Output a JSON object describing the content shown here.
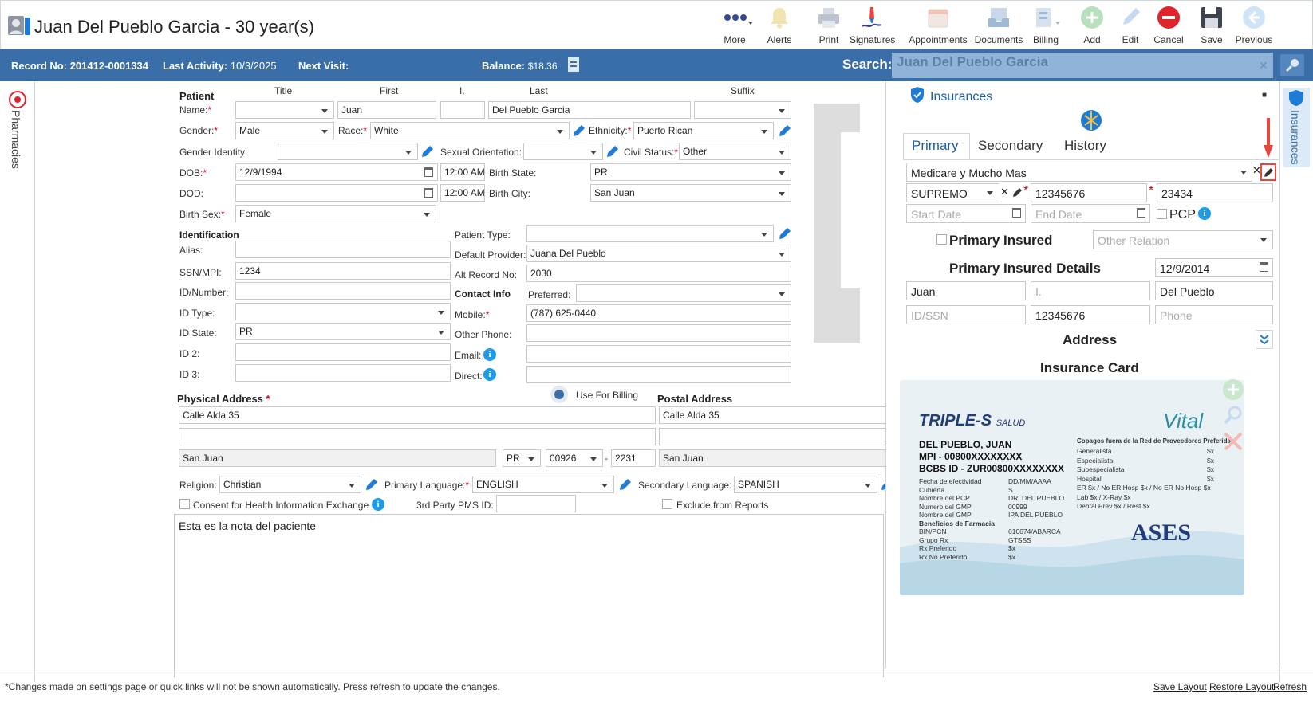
{
  "window": {
    "title": "Juan Del Pueblo Garcia - 30 year(s)"
  },
  "toolbar": {
    "more": "More",
    "alerts": "Alerts",
    "print": "Print",
    "signatures": "Signatures",
    "appointments": "Appointments",
    "documents": "Documents",
    "billing": "Billing",
    "add": "Add",
    "edit": "Edit",
    "cancel": "Cancel",
    "save": "Save",
    "previous": "Previous"
  },
  "infobar": {
    "record_label": "Record No:",
    "record_value": "201412-0001334",
    "activity_label": "Last Activity:",
    "activity_value": "10/3/2025",
    "next_visit_label": "Next Visit:",
    "balance_label": "Balance:",
    "balance_value": "$18.36",
    "search_label": "Search:",
    "search_value": "Juan Del Pueblo Garcia"
  },
  "side_tabs": {
    "left": "Pharmacies",
    "right": "Insurances"
  },
  "patient": {
    "section": "Patient",
    "col_title": "Title",
    "col_first": "First",
    "col_i": "I.",
    "col_last": "Last",
    "col_suffix": "Suffix",
    "name_label": "Name:",
    "first": "Juan",
    "last": "Del Pueblo Garcia",
    "gender_label": "Gender:",
    "gender": "Male",
    "race_label": "Race:",
    "race": "White",
    "ethnicity_label": "Ethnicity:",
    "ethnicity": "Puerto Rican",
    "gender_identity_label": "Gender Identity:",
    "sexual_orientation_label": "Sexual Orientation:",
    "civil_status_label": "Civil Status:",
    "civil_status": "Other",
    "dob_label": "DOB:",
    "dob": "12/9/1994",
    "dob_time": "12:00 AM",
    "birth_state_label": "Birth State:",
    "birth_state": "PR",
    "dod_label": "DOD:",
    "dod_time": "12:00 AM",
    "birth_city_label": "Birth City:",
    "birth_city": "San Juan",
    "birth_sex_label": "Birth Sex:",
    "birth_sex": "Female"
  },
  "identification": {
    "section": "Identification",
    "alias_label": "Alias:",
    "ssn_label": "SSN/MPI:",
    "ssn": "1234",
    "id_number_label": "ID/Number:",
    "id_type_label": "ID Type:",
    "id_state_label": "ID State:",
    "id_state": "PR",
    "id2_label": "ID 2:",
    "id3_label": "ID 3:",
    "patient_type_label": "Patient Type:",
    "default_provider_label": "Default Provider:",
    "default_provider": "Juana Del Pueblo",
    "alt_record_label": "Alt Record No:",
    "alt_record": "2030"
  },
  "contact": {
    "section": "Contact Info",
    "preferred_label": "Preferred:",
    "mobile_label": "Mobile:",
    "mobile": "(787) 625-0440",
    "other_phone_label": "Other Phone:",
    "email_label": "Email:",
    "direct_label": "Direct:"
  },
  "address": {
    "physical_title": "Physical Address",
    "use_for_billing": "Use For Billing",
    "postal_title": "Postal Address",
    "line1": "Calle Alda 35",
    "city": "San Juan",
    "state": "PR",
    "zip": "00926",
    "zip4": "2231",
    "postal_line1": "Calle Alda 35",
    "postal_city": "San Juan"
  },
  "misc": {
    "religion_label": "Religion:",
    "religion": "Christian",
    "primary_language_label": "Primary Language:",
    "primary_language": "ENGLISH",
    "secondary_language_label": "Secondary Language:",
    "secondary_language": "SPANISH",
    "consent_label": "Consent for Health Information Exchange",
    "pms_label": "3rd Party PMS ID:",
    "exclude_label": "Exclude from Reports",
    "notes": "Esta es la nota del paciente"
  },
  "insurances": {
    "title": "Insurances",
    "tabs": [
      "Primary",
      "Secondary",
      "History"
    ],
    "plan": "Medicare y Mucho Mas",
    "group": "SUPREMO",
    "policy": "12345676",
    "group_no": "23434",
    "start_date_ph": "Start Date",
    "end_date_ph": "End Date",
    "pcp_label": "PCP",
    "primary_insured_label": "Primary Insured",
    "relation_ph": "Other Relation",
    "details_title": "Primary Insured Details",
    "insured_dob": "12/9/2014",
    "insured_first": "Juan",
    "insured_mi_ph": "I.",
    "insured_last": "Del Pueblo",
    "id_ssn_ph": "ID/SSN",
    "insured_id": "12345676",
    "phone_ph": "Phone",
    "address_title": "Address",
    "card_title": "Insurance Card"
  },
  "card": {
    "brand": "TRIPLE-S",
    "brand_sub": "SALUD",
    "vital": "Vital",
    "name": "DEL PUEBLO, JUAN",
    "mpi": "MPI - 00800XXXXXXXX",
    "bcbs": "BCBS ID - ZUR00800XXXXXXXX",
    "left_labels": [
      "Fecha de efectividad",
      "Cubierta",
      "Nombre del PCP",
      "Numero del GMP",
      "Nombre del GMP",
      "Beneficios de Farmacia",
      "BIN/PCN",
      "Grupo Rx",
      "Rx Preferido",
      "Rx No Preferido"
    ],
    "left_values": [
      "DD/MM/AAAA",
      "S",
      "DR. DEL PUEBLO",
      "00999",
      "IPA DEL PUEBLO",
      "",
      "610674/ABARCA",
      "GTSSS",
      "$x",
      "$x"
    ],
    "copay_title": "Copagos fuera de la Red de Proveedores Preferida",
    "copay_labels": [
      "Generalista",
      "Especialista",
      "Subespecialista",
      "Hospital",
      "ER $x / No ER Hosp $x / No ER No Hosp $x",
      "Lab $x / X-Ray $x",
      "Dental Prev $x / Rest $x"
    ],
    "copay_values": [
      "$x",
      "$x",
      "$x",
      "$x",
      "",
      "",
      ""
    ],
    "ases": "ASES"
  },
  "footer": {
    "note": "*Changes made on settings page or quick links will not be shown automatically. Press refresh to update the changes.",
    "save_layout": "Save Layout",
    "restore_layout": "Restore Layout",
    "refresh": "Refresh"
  },
  "colors": {
    "header_blue": "#3a6ea8",
    "accent": "#1e7bd6",
    "cancel_red": "#e0242b",
    "add_green": "#57b85f",
    "arrow_red": "#e8453c"
  }
}
